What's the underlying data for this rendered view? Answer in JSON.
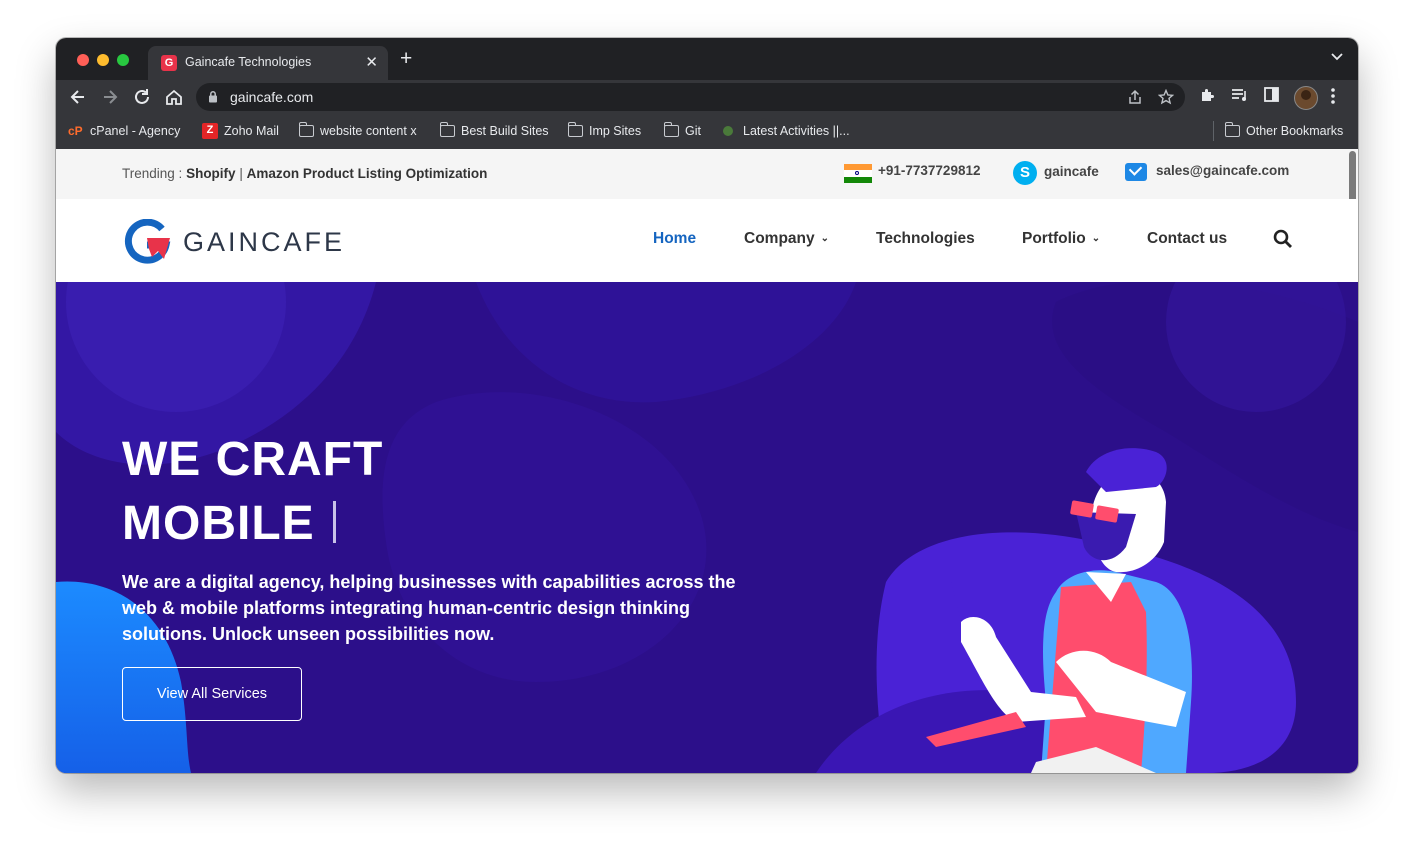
{
  "browser": {
    "tab_title": "Gaincafe Technologies",
    "tab_favicon": "G",
    "url": "gaincafe.com",
    "bookmarks": [
      {
        "label": "cPanel - Agency",
        "icon": "cpanel-icon"
      },
      {
        "label": "Zoho Mail",
        "icon": "zoho-icon"
      },
      {
        "label": "website content x",
        "icon": "folder-icon"
      },
      {
        "label": "Best Build Sites",
        "icon": "folder-icon"
      },
      {
        "label": "Imp Sites",
        "icon": "folder-icon"
      },
      {
        "label": "Git",
        "icon": "folder-icon"
      },
      {
        "label": "Latest Activities ||...",
        "icon": "site-icon"
      }
    ],
    "other_bookmarks": "Other Bookmarks"
  },
  "topbar": {
    "trending_label": "Trending :",
    "trending_1": "Shopify",
    "trending_sep": "|",
    "trending_2": "Amazon Product Listing Optimization",
    "phone": "+91-7737729812",
    "skype": "gaincafe",
    "email": "sales@gaincafe.com"
  },
  "nav": {
    "logo_text": "GAINCAFE",
    "items": [
      {
        "label": "Home",
        "active": true
      },
      {
        "label": "Company",
        "dropdown": true
      },
      {
        "label": "Technologies"
      },
      {
        "label": "Portfolio",
        "dropdown": true
      },
      {
        "label": "Contact us"
      }
    ]
  },
  "hero": {
    "line1": "WE CRAFT",
    "line2": "MOBILE",
    "paragraph": "We are a digital agency, helping businesses with capabilities across the web & mobile platforms integrating human-centric design thinking solutions. Unlock unseen possibilities now.",
    "button": "View All Services"
  },
  "colors": {
    "accent": "#1565c0",
    "hero_bg": "#2c0f8a",
    "brand_red": "#e8334a",
    "chrome_dark": "#202124",
    "chrome_mid": "#35363a"
  }
}
